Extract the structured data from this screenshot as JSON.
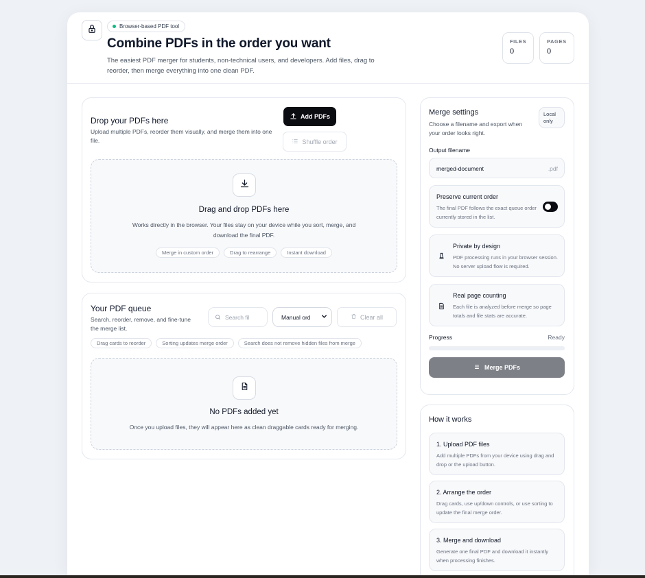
{
  "header": {
    "badge": "Browser-based PDF tool",
    "title": "Combine PDFs in the order you want",
    "subtitle": "The easiest PDF merger for students, non-technical users, and developers. Add files, drag to reorder, then merge everything into one clean PDF.",
    "stats": [
      {
        "label": "FILES",
        "value": "0"
      },
      {
        "label": "PAGES",
        "value": "0"
      }
    ]
  },
  "drop": {
    "title": "Drop your PDFs here",
    "description": "Upload multiple PDFs, reorder them visually, and merge them into one file.",
    "add_button": "Add PDFs",
    "shuffle_button": "Shuffle order",
    "zone_title": "Drag and drop PDFs here",
    "zone_text": "Works directly in the browser. Your files stay on your device while you sort, merge, and download the final PDF.",
    "chips": [
      "Merge in custom order",
      "Drag to rearrange",
      "Instant download"
    ]
  },
  "queue": {
    "title": "Your PDF queue",
    "description": "Search, reorder, remove, and fine-tune the merge list.",
    "search_placeholder": "Search fil",
    "sort_value": "Manual ord",
    "clear_button": "Clear all",
    "chips": [
      "Drag cards to reorder",
      "Sorting updates merge order",
      "Search does not remove hidden files from merge"
    ],
    "empty_title": "No PDFs added yet",
    "empty_text": "Once you upload files, they will appear here as clean draggable cards ready for merging."
  },
  "settings": {
    "title": "Merge settings",
    "description": "Choose a filename and export when your order looks right.",
    "local_badge": "Local only",
    "filename_label": "Output filename",
    "filename_value": "merged-document",
    "extension": ".pdf",
    "preserve_title": "Preserve current order",
    "preserve_desc": "The final PDF follows the exact queue order currently stored in the list.",
    "private_title": "Private by design",
    "private_desc": "PDF processing runs in your browser session. No server upload flow is required.",
    "count_title": "Real page counting",
    "count_desc": "Each file is analyzed before merge so page totals and file stats are accurate.",
    "progress_label": "Progress",
    "progress_status": "Ready",
    "progress_fraction": 0,
    "merge_button": "Merge PDFs"
  },
  "how": {
    "title": "How it works",
    "steps": [
      {
        "title": "1. Upload PDF files",
        "desc": "Add multiple PDFs from your device using drag and drop or the upload button."
      },
      {
        "title": "2. Arrange the order",
        "desc": "Drag cards, use up/down controls, or use sorting to update the final merge order."
      },
      {
        "title": "3. Merge and download",
        "desc": "Generate one final PDF and download it instantly when processing finishes."
      }
    ]
  },
  "colors": {
    "accent_dark": "#0b0b12",
    "merge_button_bg": "#7d8087",
    "status_dot": "#10b981"
  }
}
